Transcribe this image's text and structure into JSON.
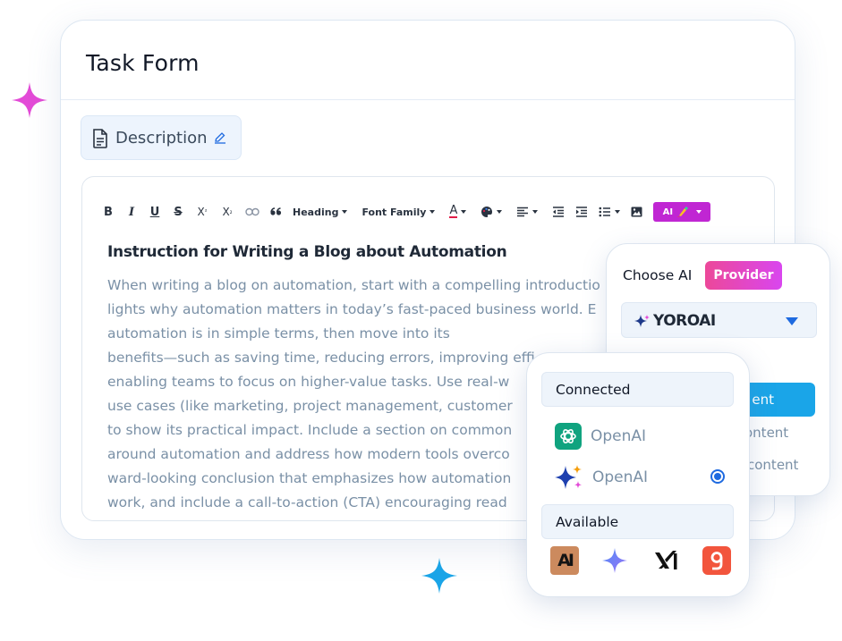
{
  "colors": {
    "accent": "#c026d3",
    "pink_sparkle": "#e34bd7",
    "blue_sparkle": "#1aa5e8",
    "primary_blue": "#1e6ae0",
    "muted_text": "#7a90a6"
  },
  "card": {
    "title": "Task Form"
  },
  "description": {
    "label": "Description"
  },
  "toolbar": {
    "bold": "B",
    "italic": "I",
    "underline": "U",
    "strike": "S",
    "superscript_base": "X",
    "superscript_mark": "²",
    "subscript_base": "X",
    "subscript_mark": "₂",
    "heading_label": "Heading",
    "font_family_label": "Font Family",
    "font_color_label": "A",
    "ai_label": "AI"
  },
  "document": {
    "heading": "Instruction for Writing a Blog about Automation",
    "lines": [
      "When writing a blog on automation, start with a compelling introductio",
      "lights why automation matters in today’s fast-paced business world. E",
      "automation is in simple terms, then move into its",
      "benefits—such as saving time, reducing errors, improving effi",
      "enabling teams to focus on higher-value tasks. Use real-w",
      "use cases (like marketing, project management, customer",
      "to show its practical impact. Include a section on common",
      "around automation and address how modern tools overco",
      "ward-looking conclusion that emphasizes how automation",
      "work, and include a call-to-action (CTA) encouraging read"
    ]
  },
  "provider_panel": {
    "choose_label": "Choose AI",
    "badge_label": "Provider",
    "selected_value": "YOROAI",
    "content_button_label": "ent",
    "content_lines": [
      "ontent",
      "content"
    ]
  },
  "dropdown": {
    "connected_label": "Connected",
    "options": [
      {
        "name": "OpenAI",
        "icon": "openai-icon"
      },
      {
        "name": "OpenAI",
        "icon": "gemini-sparkle-icon",
        "selected": true
      }
    ],
    "available_label": "Available",
    "available_icons": [
      "anthropic-icon",
      "gemini-icon",
      "xai-icon",
      "gamma-icon"
    ]
  }
}
